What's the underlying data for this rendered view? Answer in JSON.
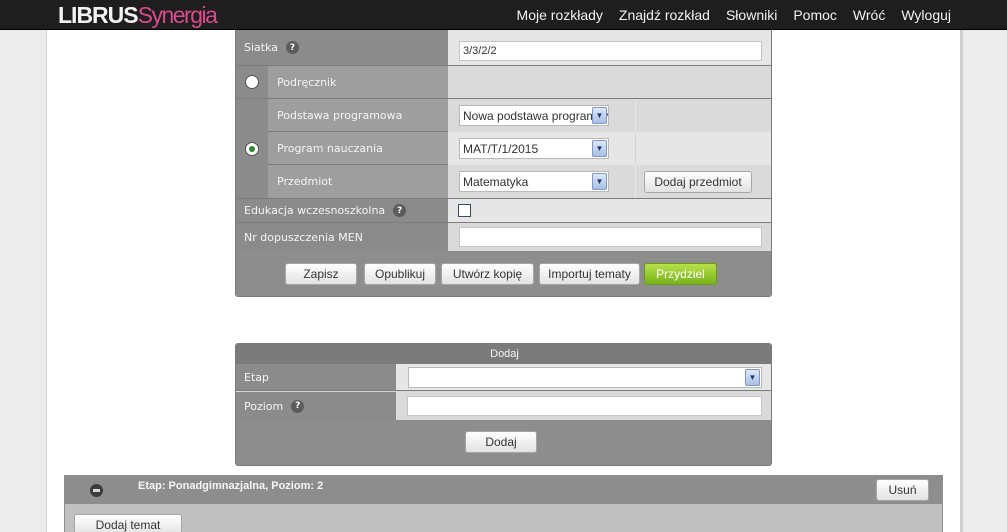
{
  "header": {
    "logo_part1": "LIBRUS",
    "logo_part2": "Synergia",
    "nav": [
      "Moje rozkłady",
      "Znajdź rozkład",
      "Słowniki",
      "Pomoc",
      "Wróć",
      "Wyloguj"
    ]
  },
  "form": {
    "siatka": {
      "label": "Siatka",
      "value": "3/3/2/2"
    },
    "podrecznik": {
      "label": "Podręcznik",
      "selected": false
    },
    "program_option": {
      "selected": true
    },
    "podstawa": {
      "label": "Podstawa programowa",
      "value": "Nowa podstawa programowa"
    },
    "program": {
      "label": "Program nauczania",
      "value": "MAT/T/1/2015"
    },
    "przedmiot": {
      "label": "Przedmiot",
      "value": "Matematyka",
      "button": "Dodaj przedmiot"
    },
    "edukacja": {
      "label": "Edukacja wczesnoszkolna",
      "checked": false
    },
    "nr_men": {
      "label": "Nr dopuszczenia MEN",
      "value": ""
    },
    "help_glyph": "?",
    "select_arrow": "▼",
    "buttons": {
      "zapisz": "Zapisz",
      "opublikuj": "Opublikuj",
      "utworz": "Utwórz kopię",
      "importuj": "Importuj tematy",
      "przydziel": "Przydziel"
    }
  },
  "dodaj_panel": {
    "title": "Dodaj",
    "etap_label": "Etap",
    "etap_value": "",
    "poziom_label": "Poziom",
    "poziom_value": "",
    "button": "Dodaj"
  },
  "etap_panel": {
    "title": "Etap: Ponadgimnazjalna, Poziom: 2",
    "delete_button": "Usuń",
    "add_topic_button": "Dodaj temat"
  },
  "colors": {
    "accent_green": "#8cc326",
    "logo_pink": "#d94a8c",
    "topbar": "#1e1e1e"
  }
}
